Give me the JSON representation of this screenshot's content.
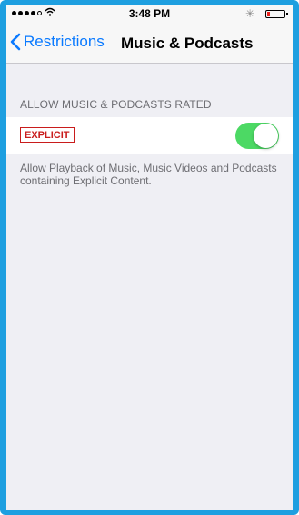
{
  "status_bar": {
    "time": "3:48 PM",
    "wifi_icon": "wifi-icon",
    "bluetooth_icon": "bluetooth-icon",
    "battery_color": "#e8201b"
  },
  "nav": {
    "back_label": "Restrictions",
    "title": "Music & Podcasts",
    "accent_color": "#0a7aff"
  },
  "section": {
    "header": "ALLOW MUSIC & PODCASTS RATED",
    "badge_label": "EXPLICIT",
    "toggle_on": true,
    "toggle_color": "#4cd964",
    "footer": "Allow Playback of Music, Music Videos and Podcasts containing Explicit Content."
  }
}
